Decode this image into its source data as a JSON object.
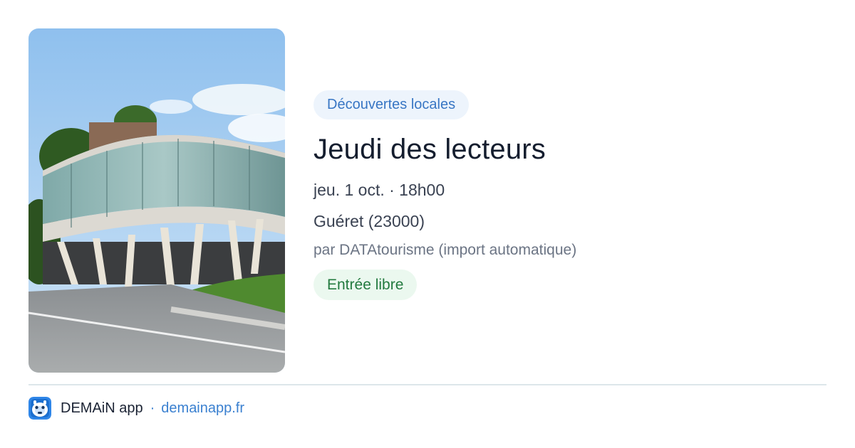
{
  "event": {
    "image": {
      "alt": "",
      "icon": "building-photo"
    },
    "category": "Découvertes locales",
    "title": "Jeudi des lecteurs",
    "date": "jeu. 1 oct. · 18h00",
    "place": "Guéret (23000)",
    "organizer": "par DATAtourisme (import automatique)",
    "price": "Entrée libre"
  },
  "footer": {
    "app_icon": "demain-app-icon",
    "app_name": "DEMAiN app",
    "separator": "·",
    "url": "demainapp.fr"
  },
  "colors": {
    "category_chip_bg": "#edf4fc",
    "category_chip_text": "#3876c4",
    "price_chip_bg": "#ebf8ef",
    "price_chip_text": "#237a3f",
    "link": "#3a80d0",
    "divider": "#dde6ea",
    "logo": "#2f86e8"
  }
}
